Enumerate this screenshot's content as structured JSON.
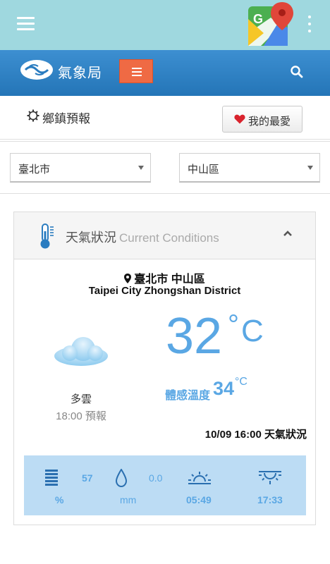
{
  "appbar": {
    "menu_icon": "hamburger-icon",
    "maps_icon": "google-maps-icon",
    "overflow_icon": "more-vert-icon"
  },
  "header": {
    "brand": "氣象局",
    "menu_icon": "menu-icon",
    "search_icon": "search-icon",
    "colors": {
      "header": "#2d7fc1",
      "menu_button": "#ef6a44"
    }
  },
  "town": {
    "label": "鄉鎮預報",
    "icon": "gear-icon",
    "favorite_label": "我的最愛",
    "favorite_icon": "heart-icon"
  },
  "selects": {
    "city": "臺北市",
    "district": "中山區"
  },
  "card": {
    "title_zh": "天氣狀況",
    "title_en": "Current Conditions",
    "location_zh": "臺北市 中山區",
    "location_en": "Taipei City Zhongshan District",
    "condition": "多雲",
    "forecast_time": "18:00 預報",
    "temperature": "32",
    "temp_unit": "C",
    "feels_label": "體感溫度",
    "feels_value": "34",
    "feels_unit": "C",
    "observed": "10/09 16:00 天氣狀況",
    "stats": {
      "humidity": "57",
      "humidity_unit": "%",
      "rain": "0.0",
      "rain_unit": "mm",
      "sunrise": "05:49",
      "sunset": "17:33"
    }
  }
}
